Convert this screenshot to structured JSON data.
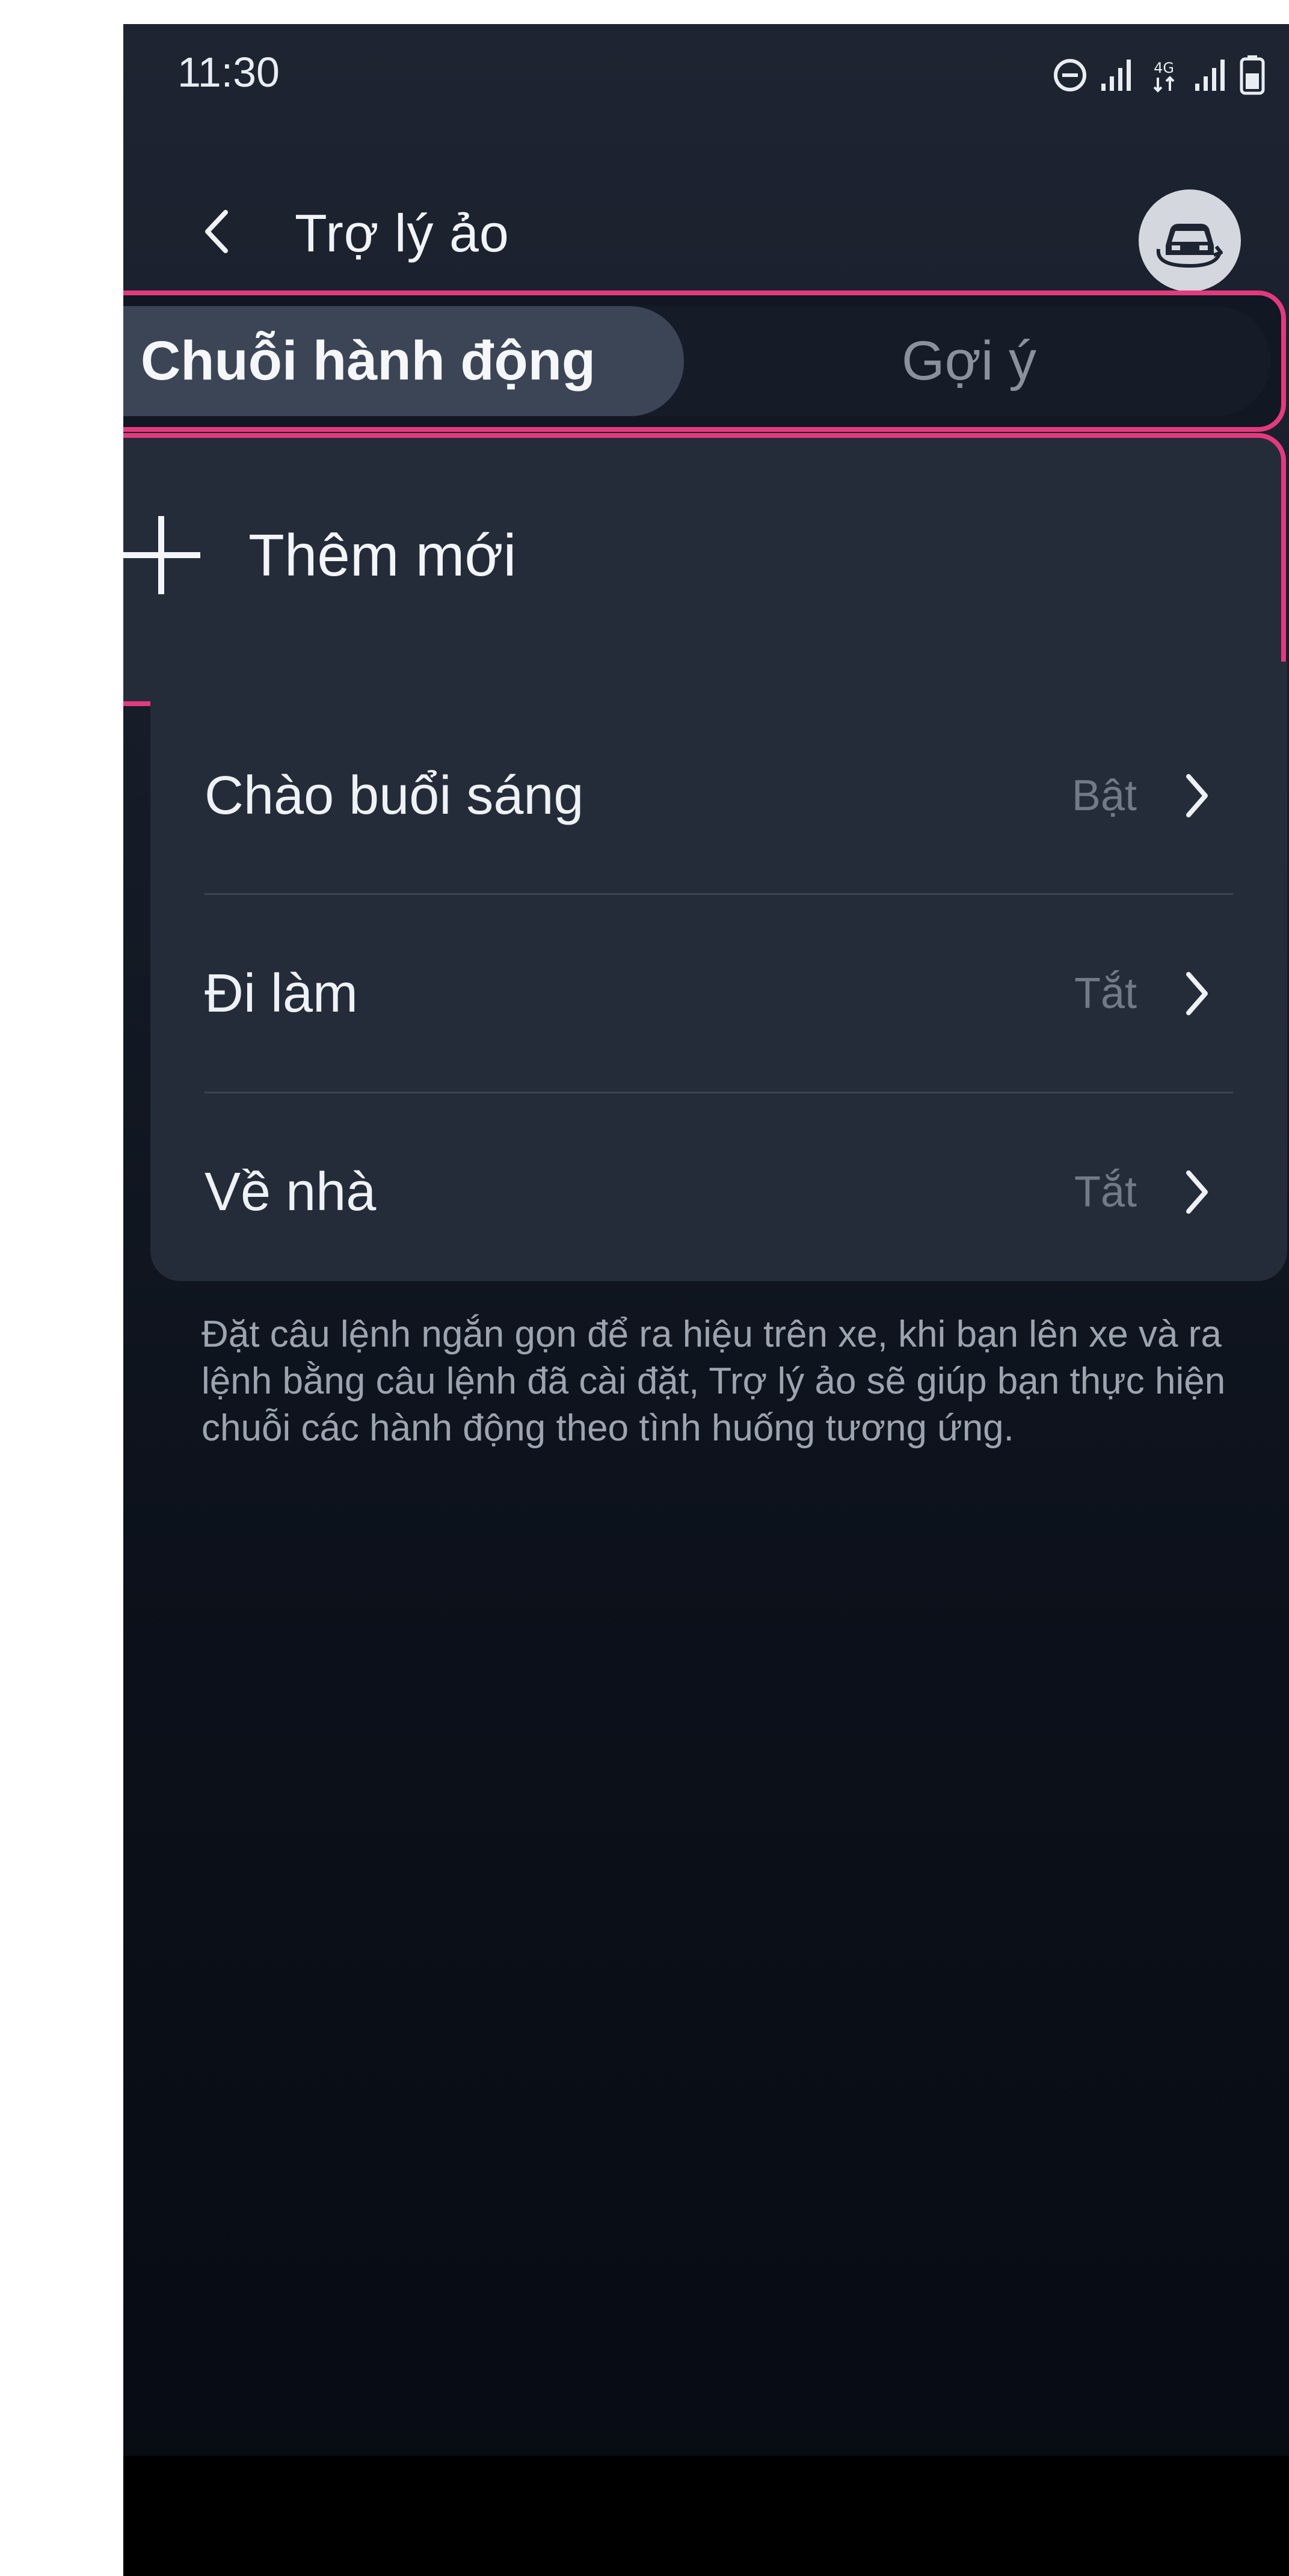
{
  "status_bar": {
    "time": "11:30",
    "network": "4G"
  },
  "header": {
    "title": "Trợ lý ảo"
  },
  "tabs": [
    {
      "label": "Chuỗi hành động",
      "active": true
    },
    {
      "label": "Gợi ý",
      "active": false
    }
  ],
  "add_new": {
    "label": "Thêm mới"
  },
  "routines": [
    {
      "label": "Chào buổi sáng",
      "status": "Bật"
    },
    {
      "label": "Đi làm",
      "status": "Tắt"
    },
    {
      "label": "Về nhà",
      "status": "Tắt"
    }
  ],
  "description": "Đặt câu lệnh ngắn gọn để ra hiệu trên xe, khi bạn lên xe và ra lệnh bằng câu lệnh đã cài đặt, Trợ lý ảo sẽ giúp bạn thực hiện chuỗi các hành động theo tình huống tương ứng.",
  "icons": {
    "back": "chevron-left-icon",
    "car": "car-sync-icon",
    "plus": "plus-icon",
    "row_chevron": "chevron-right-icon"
  },
  "colors": {
    "highlight": "#e33a7e",
    "background": "#141a25",
    "card": "#252c39",
    "active_tab": "#3c4556"
  }
}
